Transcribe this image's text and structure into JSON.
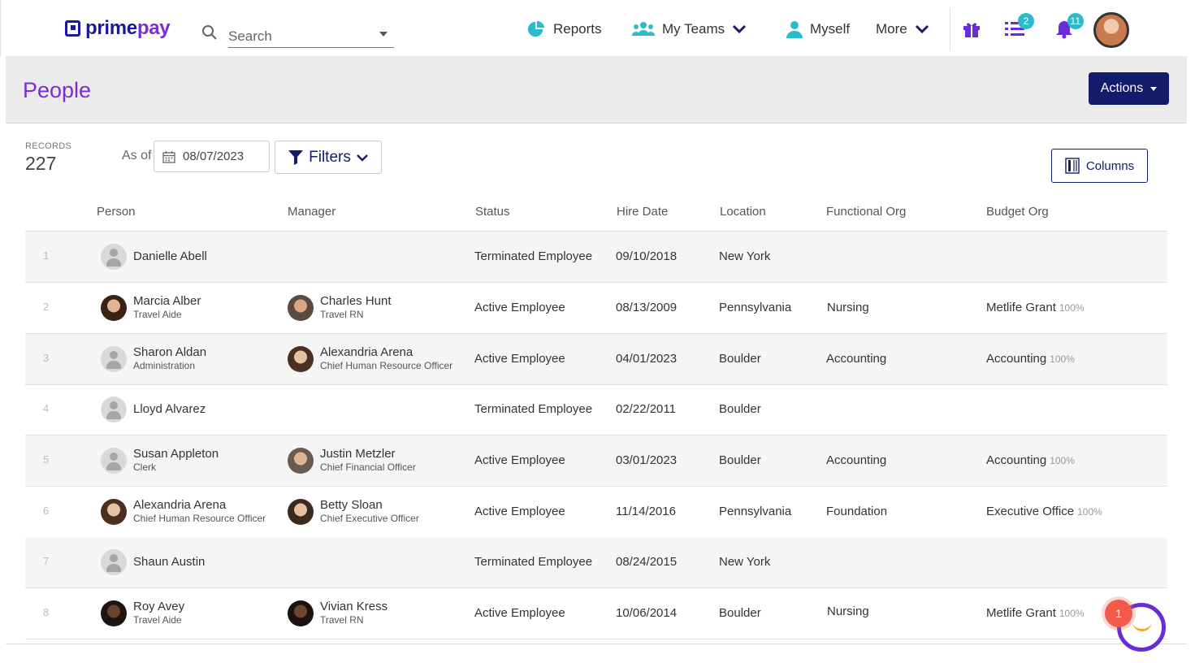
{
  "brand": {
    "part1": "prime",
    "part2": "pay"
  },
  "search": {
    "placeholder": "Search"
  },
  "nav": {
    "reports": "Reports",
    "my_teams": "My Teams",
    "myself": "Myself",
    "more": "More",
    "tasks_badge": "2",
    "notifications_badge": "11"
  },
  "page": {
    "title": "People",
    "actions_label": "Actions"
  },
  "toolbar": {
    "records_label": "RECORDS",
    "records_count": "227",
    "as_of_label": "As of",
    "as_of_date": "08/07/2023",
    "filters_label": "Filters",
    "columns_label": "Columns"
  },
  "table": {
    "headers": {
      "person": "Person",
      "manager": "Manager",
      "status": "Status",
      "hire_date": "Hire Date",
      "location": "Location",
      "functional_org": "Functional Org",
      "budget_org": "Budget Org"
    },
    "rows": [
      {
        "index": "1",
        "person": "Danielle Abell",
        "person_title": "",
        "manager": "",
        "manager_title": "",
        "status": "Terminated Employee",
        "hire_date": "09/10/2018",
        "location": "New York",
        "functional_org": "",
        "budget_org": "",
        "budget_pct": ""
      },
      {
        "index": "2",
        "person": "Marcia Alber",
        "person_title": "Travel Aide",
        "manager": "Charles Hunt",
        "manager_title": "Travel RN",
        "status": "Active Employee",
        "hire_date": "08/13/2009",
        "location": "Pennsylvania",
        "functional_org": "Nursing",
        "budget_org": "Metlife Grant",
        "budget_pct": "100%"
      },
      {
        "index": "3",
        "person": "Sharon Aldan",
        "person_title": "Administration",
        "manager": "Alexandria Arena",
        "manager_title": "Chief Human Resource Officer",
        "status": "Active Employee",
        "hire_date": "04/01/2023",
        "location": "Boulder",
        "functional_org": "Accounting",
        "budget_org": "Accounting",
        "budget_pct": "100%"
      },
      {
        "index": "4",
        "person": "Lloyd Alvarez",
        "person_title": "",
        "manager": "",
        "manager_title": "",
        "status": "Terminated Employee",
        "hire_date": "02/22/2011",
        "location": "Boulder",
        "functional_org": "",
        "budget_org": "",
        "budget_pct": ""
      },
      {
        "index": "5",
        "person": "Susan Appleton",
        "person_title": "Clerk",
        "manager": "Justin Metzler",
        "manager_title": "Chief Financial Officer",
        "status": "Active Employee",
        "hire_date": "03/01/2023",
        "location": "Boulder",
        "functional_org": "Accounting",
        "budget_org": "Accounting",
        "budget_pct": "100%"
      },
      {
        "index": "6",
        "person": "Alexandria Arena",
        "person_title": "Chief Human Resource Officer",
        "manager": "Betty Sloan",
        "manager_title": "Chief Executive Officer",
        "status": "Active Employee",
        "hire_date": "11/14/2016",
        "location": "Pennsylvania",
        "functional_org": "Foundation",
        "budget_org": "Executive Office",
        "budget_pct": "100%"
      },
      {
        "index": "7",
        "person": "Shaun Austin",
        "person_title": "",
        "manager": "",
        "manager_title": "",
        "status": "Terminated Employee",
        "hire_date": "08/24/2015",
        "location": "New York",
        "functional_org": "",
        "budget_org": "",
        "budget_pct": ""
      },
      {
        "index": "8",
        "person": "Roy Avey",
        "person_title": "Travel Aide",
        "manager": "Vivian Kress",
        "manager_title": "Travel RN",
        "status": "Active Employee",
        "hire_date": "10/06/2014",
        "location": "Boulder",
        "functional_org": "Nursing",
        "budget_org": "Metlife Grant",
        "budget_pct": "100%"
      }
    ]
  },
  "chat": {
    "badge": "1"
  },
  "icons": [
    "search-icon",
    "pie-chart-icon",
    "team-icon",
    "user-icon",
    "chevron-down-icon",
    "gift-icon",
    "task-list-icon",
    "bell-icon",
    "calendar-icon",
    "filter-icon",
    "columns-icon",
    "chat-icon"
  ],
  "colors": {
    "brand_purple": "#7b2bd9",
    "brand_navy": "#131c6b",
    "accent_teal": "#2bbbcc",
    "chat_badge": "#f45a4a"
  }
}
